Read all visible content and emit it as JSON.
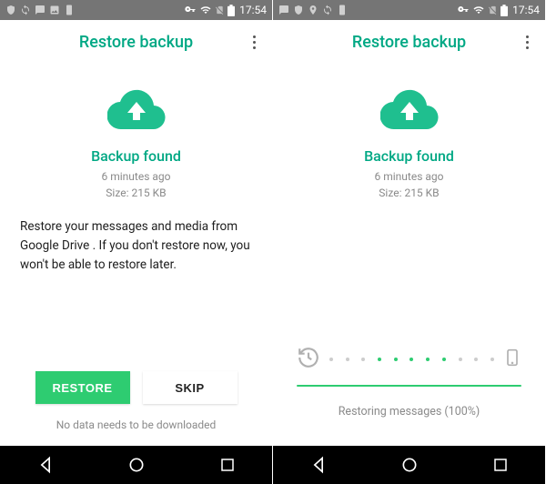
{
  "status": {
    "time": "17:54"
  },
  "left": {
    "title": "Restore backup",
    "found": "Backup found",
    "ago": "6 minutes ago",
    "size": "Size: 215 KB",
    "body": "Restore your messages and media from Google Drive . If you don't restore now, you won't be able to restore later.",
    "restore": "RESTORE",
    "skip": "SKIP",
    "footer": "No data needs to be downloaded"
  },
  "right": {
    "title": "Restore backup",
    "found": "Backup found",
    "ago": "6 minutes ago",
    "size": "Size: 215 KB",
    "progress": "Restoring messages (100%)"
  }
}
